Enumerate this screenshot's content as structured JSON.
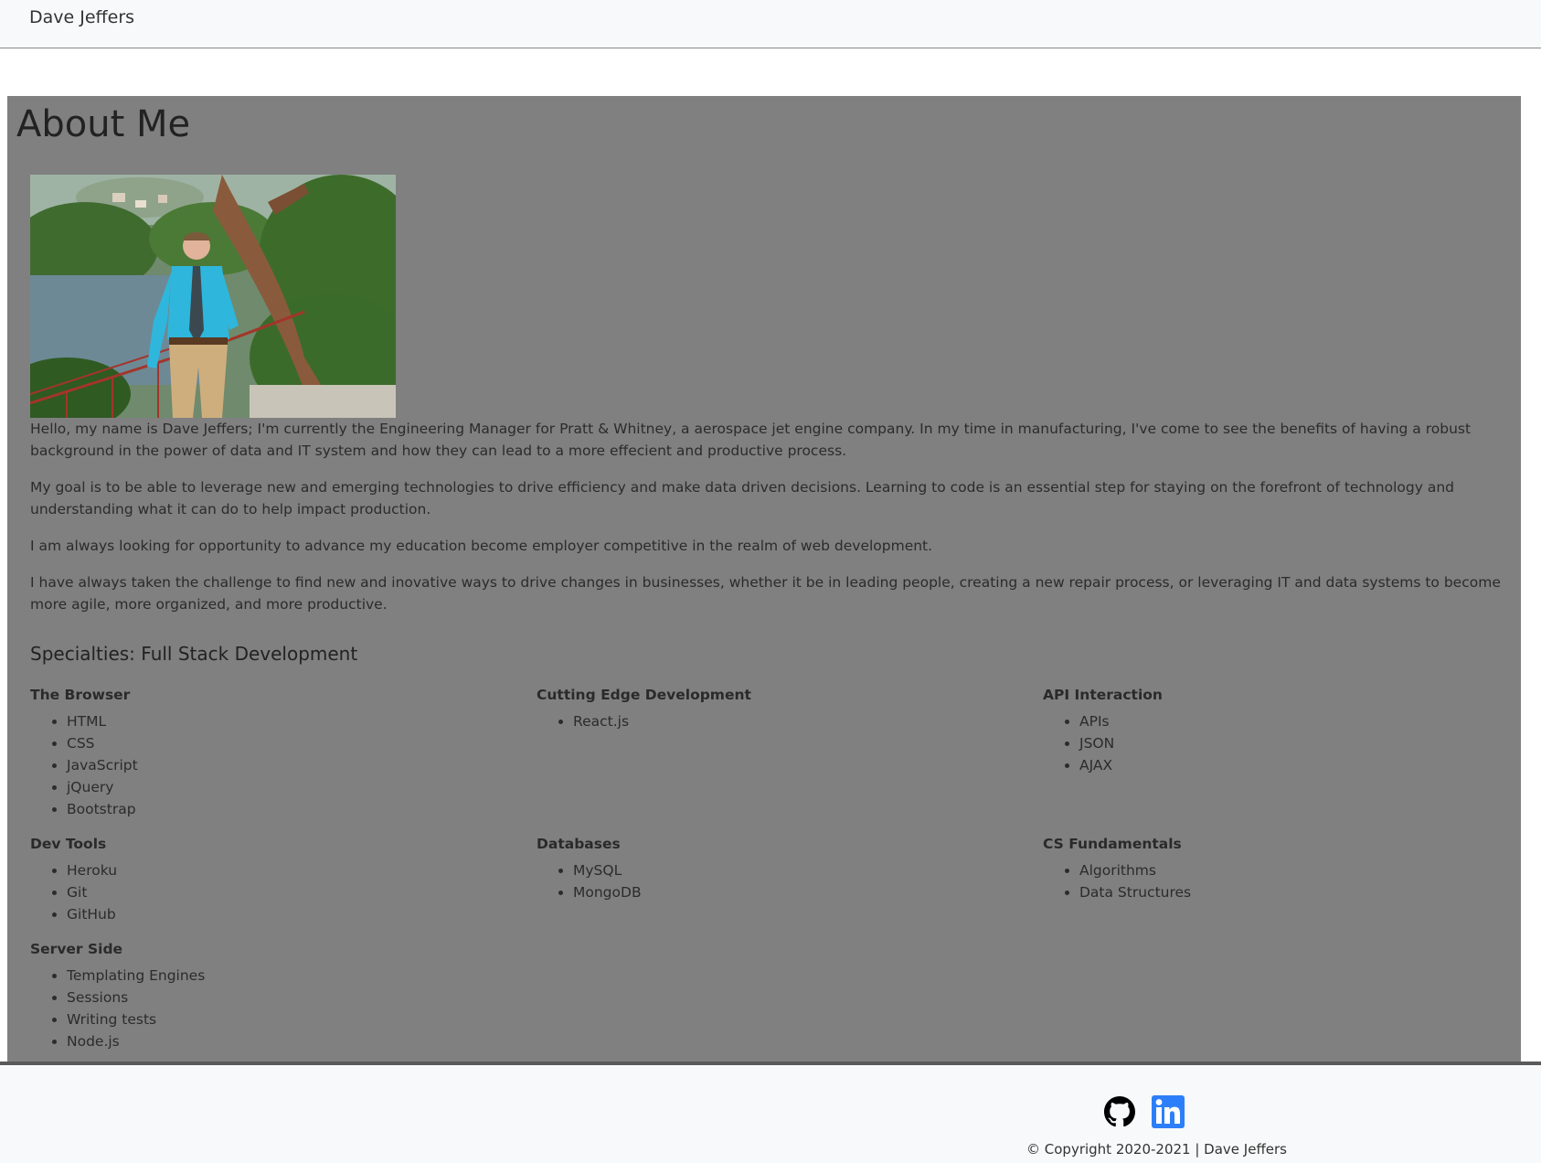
{
  "navbar": {
    "brand": "Dave Jeffers"
  },
  "about": {
    "title": "About Me",
    "paragraphs": [
      "Hello, my name is Dave Jeffers; I'm currently the Engineering Manager for Pratt & Whitney, a aerospace jet engine company. In my time in manufacturing, I've come to see the benefits of having a robust background in the power of data and IT system and how they can lead to a more effecient and productive process.",
      "My goal is to be able to leverage new and emerging technologies to drive efficiency and make data driven decisions. Learning to code is an essential step for staying on the forefront of technology and understanding what it can do to help impact production.",
      "I am always looking for opportunity to advance my education become employer competitive in the realm of web development.",
      "I have always taken the challenge to find new and inovative ways to drive changes in businesses, whether it be in leading people, creating a new repair process, or leveraging IT and data systems to become more agile, more organized, and more productive."
    ],
    "specialties_heading": "Specialties: Full Stack Development",
    "skill_groups": [
      {
        "title": "The Browser",
        "items": [
          "HTML",
          "CSS",
          "JavaScript",
          "jQuery",
          "Bootstrap"
        ]
      },
      {
        "title": "Cutting Edge Development",
        "items": [
          "React.js"
        ]
      },
      {
        "title": "API Interaction",
        "items": [
          "APIs",
          "JSON",
          "AJAX"
        ]
      },
      {
        "title": "Dev Tools",
        "items": [
          "Heroku",
          "Git",
          "GitHub"
        ]
      },
      {
        "title": "Databases",
        "items": [
          "MySQL",
          "MongoDB"
        ]
      },
      {
        "title": "CS Fundamentals",
        "items": [
          "Algorithms",
          "Data Structures"
        ]
      },
      {
        "title": "Server Side",
        "items": [
          "Templating Engines",
          "Sessions",
          "Writing tests",
          "Node.js"
        ]
      }
    ]
  },
  "footer": {
    "icons": [
      "github-icon",
      "linkedin-icon"
    ],
    "linkedin_color": "#2d7ff9",
    "copyright": "© Copyright 2020-2021 | Dave Jeffers"
  }
}
